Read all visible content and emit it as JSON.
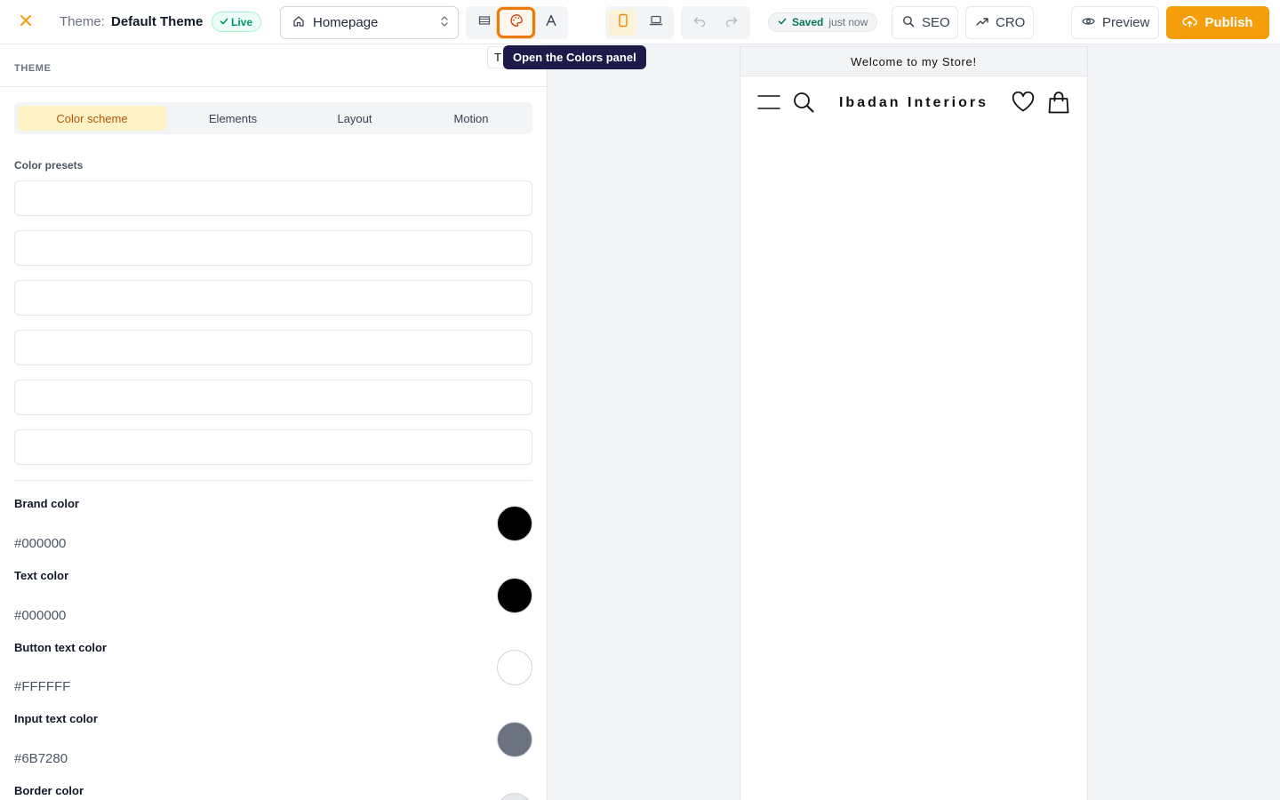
{
  "header": {
    "theme_label": "Theme:",
    "theme_name": "Default Theme",
    "live_badge": "Live",
    "page_select": "Homepage",
    "saved_status": "Saved",
    "saved_time": "just now",
    "seo_label": "SEO",
    "cro_label": "CRO",
    "preview_label": "Preview",
    "publish_label": "Publish"
  },
  "tooltip": {
    "ghost_char": "T",
    "text": "Open the Colors panel"
  },
  "sidebar": {
    "title": "THEME",
    "tabs": [
      {
        "label": "Color scheme",
        "active": true
      },
      {
        "label": "Elements",
        "active": false
      },
      {
        "label": "Layout",
        "active": false
      },
      {
        "label": "Motion",
        "active": false
      }
    ],
    "presets_label": "Color presets",
    "presets_count": 6,
    "colors": [
      {
        "label": "Brand color",
        "hex": "#000000",
        "swatch": "#000000"
      },
      {
        "label": "Text color",
        "hex": "#000000",
        "swatch": "#000000"
      },
      {
        "label": "Button text color",
        "hex": "#FFFFFF",
        "swatch": "#FFFFFF"
      },
      {
        "label": "Input text color",
        "hex": "#6B7280",
        "swatch": "#6B7280"
      },
      {
        "label": "Border color",
        "hex": "",
        "swatch": "#E5E7EB"
      }
    ]
  },
  "preview": {
    "announcement": "Welcome to my Store!",
    "store_name": "Ibadan Interiors"
  },
  "colors": {
    "accent": "#F59E0B",
    "accent_dark": "#EA7A0C",
    "live_green": "#059669",
    "tooltip_bg": "#1E1B4B"
  }
}
